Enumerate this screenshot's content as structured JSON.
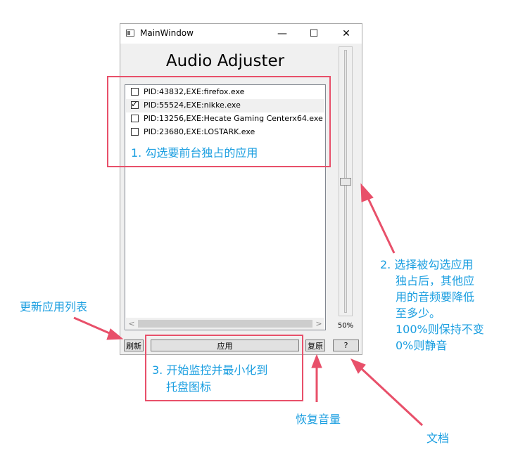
{
  "window": {
    "title": "MainWindow",
    "minimize": "—",
    "maximize": "☐",
    "close": "✕"
  },
  "heading": "Audio Adjuster",
  "processes": [
    {
      "label": "PID:43832,EXE:firefox.exe",
      "checked": false
    },
    {
      "label": "PID:55524,EXE:nikke.exe",
      "checked": true
    },
    {
      "label": "PID:13256,EXE:Hecate Gaming Centerx64.exe",
      "checked": false
    },
    {
      "label": "PID:23680,EXE:LOSTARK.exe",
      "checked": false
    }
  ],
  "volume": {
    "percent_label": "50%",
    "level": 0.5
  },
  "buttons": {
    "refresh": "刷新",
    "apply": "应用",
    "restore": "复原",
    "help": "?"
  },
  "annotations": {
    "step1": "1. 勾选要前台独占的应用",
    "step2_lines": [
      "2. 选择被勾选应用",
      "独占后，其他应",
      "用的音频要降低",
      "至多少。",
      "100%则保持不变",
      "0%则静音"
    ],
    "step3_lines": [
      "3. 开始监控并最小化到",
      "托盘图标"
    ],
    "refresh_note": "更新应用列表",
    "restore_note": "恢复音量",
    "docs_note": "文档"
  },
  "colors": {
    "annotation_text": "#1a9ee0",
    "annotation_box": "#e8506a"
  }
}
